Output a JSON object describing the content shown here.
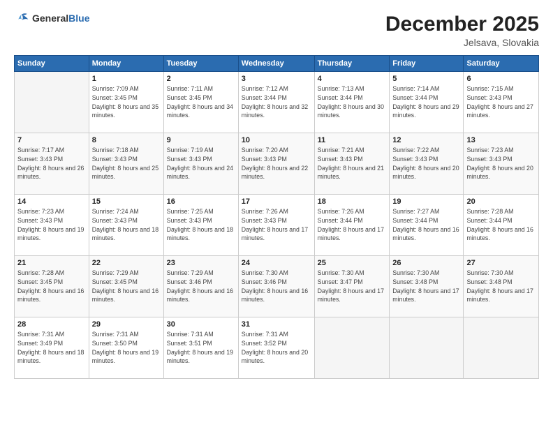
{
  "header": {
    "logo_general": "General",
    "logo_blue": "Blue",
    "month_title": "December 2025",
    "subtitle": "Jelsava, Slovakia"
  },
  "weekdays": [
    "Sunday",
    "Monday",
    "Tuesday",
    "Wednesday",
    "Thursday",
    "Friday",
    "Saturday"
  ],
  "weeks": [
    [
      {
        "day": "",
        "sunrise": "",
        "sunset": "",
        "daylight": ""
      },
      {
        "day": "1",
        "sunrise": "Sunrise: 7:09 AM",
        "sunset": "Sunset: 3:45 PM",
        "daylight": "Daylight: 8 hours and 35 minutes."
      },
      {
        "day": "2",
        "sunrise": "Sunrise: 7:11 AM",
        "sunset": "Sunset: 3:45 PM",
        "daylight": "Daylight: 8 hours and 34 minutes."
      },
      {
        "day": "3",
        "sunrise": "Sunrise: 7:12 AM",
        "sunset": "Sunset: 3:44 PM",
        "daylight": "Daylight: 8 hours and 32 minutes."
      },
      {
        "day": "4",
        "sunrise": "Sunrise: 7:13 AM",
        "sunset": "Sunset: 3:44 PM",
        "daylight": "Daylight: 8 hours and 30 minutes."
      },
      {
        "day": "5",
        "sunrise": "Sunrise: 7:14 AM",
        "sunset": "Sunset: 3:44 PM",
        "daylight": "Daylight: 8 hours and 29 minutes."
      },
      {
        "day": "6",
        "sunrise": "Sunrise: 7:15 AM",
        "sunset": "Sunset: 3:43 PM",
        "daylight": "Daylight: 8 hours and 27 minutes."
      }
    ],
    [
      {
        "day": "7",
        "sunrise": "Sunrise: 7:17 AM",
        "sunset": "Sunset: 3:43 PM",
        "daylight": "Daylight: 8 hours and 26 minutes."
      },
      {
        "day": "8",
        "sunrise": "Sunrise: 7:18 AM",
        "sunset": "Sunset: 3:43 PM",
        "daylight": "Daylight: 8 hours and 25 minutes."
      },
      {
        "day": "9",
        "sunrise": "Sunrise: 7:19 AM",
        "sunset": "Sunset: 3:43 PM",
        "daylight": "Daylight: 8 hours and 24 minutes."
      },
      {
        "day": "10",
        "sunrise": "Sunrise: 7:20 AM",
        "sunset": "Sunset: 3:43 PM",
        "daylight": "Daylight: 8 hours and 22 minutes."
      },
      {
        "day": "11",
        "sunrise": "Sunrise: 7:21 AM",
        "sunset": "Sunset: 3:43 PM",
        "daylight": "Daylight: 8 hours and 21 minutes."
      },
      {
        "day": "12",
        "sunrise": "Sunrise: 7:22 AM",
        "sunset": "Sunset: 3:43 PM",
        "daylight": "Daylight: 8 hours and 20 minutes."
      },
      {
        "day": "13",
        "sunrise": "Sunrise: 7:23 AM",
        "sunset": "Sunset: 3:43 PM",
        "daylight": "Daylight: 8 hours and 20 minutes."
      }
    ],
    [
      {
        "day": "14",
        "sunrise": "Sunrise: 7:23 AM",
        "sunset": "Sunset: 3:43 PM",
        "daylight": "Daylight: 8 hours and 19 minutes."
      },
      {
        "day": "15",
        "sunrise": "Sunrise: 7:24 AM",
        "sunset": "Sunset: 3:43 PM",
        "daylight": "Daylight: 8 hours and 18 minutes."
      },
      {
        "day": "16",
        "sunrise": "Sunrise: 7:25 AM",
        "sunset": "Sunset: 3:43 PM",
        "daylight": "Daylight: 8 hours and 18 minutes."
      },
      {
        "day": "17",
        "sunrise": "Sunrise: 7:26 AM",
        "sunset": "Sunset: 3:43 PM",
        "daylight": "Daylight: 8 hours and 17 minutes."
      },
      {
        "day": "18",
        "sunrise": "Sunrise: 7:26 AM",
        "sunset": "Sunset: 3:44 PM",
        "daylight": "Daylight: 8 hours and 17 minutes."
      },
      {
        "day": "19",
        "sunrise": "Sunrise: 7:27 AM",
        "sunset": "Sunset: 3:44 PM",
        "daylight": "Daylight: 8 hours and 16 minutes."
      },
      {
        "day": "20",
        "sunrise": "Sunrise: 7:28 AM",
        "sunset": "Sunset: 3:44 PM",
        "daylight": "Daylight: 8 hours and 16 minutes."
      }
    ],
    [
      {
        "day": "21",
        "sunrise": "Sunrise: 7:28 AM",
        "sunset": "Sunset: 3:45 PM",
        "daylight": "Daylight: 8 hours and 16 minutes."
      },
      {
        "day": "22",
        "sunrise": "Sunrise: 7:29 AM",
        "sunset": "Sunset: 3:45 PM",
        "daylight": "Daylight: 8 hours and 16 minutes."
      },
      {
        "day": "23",
        "sunrise": "Sunrise: 7:29 AM",
        "sunset": "Sunset: 3:46 PM",
        "daylight": "Daylight: 8 hours and 16 minutes."
      },
      {
        "day": "24",
        "sunrise": "Sunrise: 7:30 AM",
        "sunset": "Sunset: 3:46 PM",
        "daylight": "Daylight: 8 hours and 16 minutes."
      },
      {
        "day": "25",
        "sunrise": "Sunrise: 7:30 AM",
        "sunset": "Sunset: 3:47 PM",
        "daylight": "Daylight: 8 hours and 17 minutes."
      },
      {
        "day": "26",
        "sunrise": "Sunrise: 7:30 AM",
        "sunset": "Sunset: 3:48 PM",
        "daylight": "Daylight: 8 hours and 17 minutes."
      },
      {
        "day": "27",
        "sunrise": "Sunrise: 7:30 AM",
        "sunset": "Sunset: 3:48 PM",
        "daylight": "Daylight: 8 hours and 17 minutes."
      }
    ],
    [
      {
        "day": "28",
        "sunrise": "Sunrise: 7:31 AM",
        "sunset": "Sunset: 3:49 PM",
        "daylight": "Daylight: 8 hours and 18 minutes."
      },
      {
        "day": "29",
        "sunrise": "Sunrise: 7:31 AM",
        "sunset": "Sunset: 3:50 PM",
        "daylight": "Daylight: 8 hours and 19 minutes."
      },
      {
        "day": "30",
        "sunrise": "Sunrise: 7:31 AM",
        "sunset": "Sunset: 3:51 PM",
        "daylight": "Daylight: 8 hours and 19 minutes."
      },
      {
        "day": "31",
        "sunrise": "Sunrise: 7:31 AM",
        "sunset": "Sunset: 3:52 PM",
        "daylight": "Daylight: 8 hours and 20 minutes."
      },
      {
        "day": "",
        "sunrise": "",
        "sunset": "",
        "daylight": ""
      },
      {
        "day": "",
        "sunrise": "",
        "sunset": "",
        "daylight": ""
      },
      {
        "day": "",
        "sunrise": "",
        "sunset": "",
        "daylight": ""
      }
    ]
  ]
}
